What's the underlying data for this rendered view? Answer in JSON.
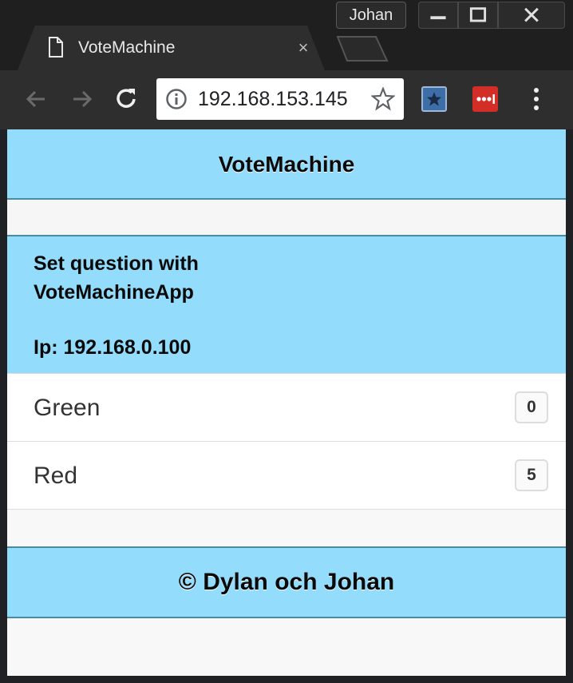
{
  "browser": {
    "profile_name": "Johan",
    "tab_title": "VoteMachine",
    "tab_close": "×",
    "url": "192.168.153.145",
    "icons": [
      "page-icon",
      "back-icon",
      "forward-icon",
      "reload-icon",
      "info-icon",
      "star-icon",
      "bookmark-extension-icon",
      "lastpass-icon",
      "menu-icon"
    ],
    "colors": {
      "frame": "#1f1f1f",
      "toolbar": "#2e2e2e",
      "omnibox": "#ffffff"
    }
  },
  "app": {
    "title": "VoteMachine",
    "question_line": "Set question with VoteMachineApp",
    "ip_line": "Ip: 192.168.0.100",
    "options": [
      {
        "label": "Green",
        "votes": "0"
      },
      {
        "label": "Red",
        "votes": "5"
      }
    ],
    "footer": "© Dylan och Johan",
    "colors": {
      "accent": "#93dcfb",
      "border": "#4a8aa3",
      "background": "#f8f8f8"
    }
  }
}
